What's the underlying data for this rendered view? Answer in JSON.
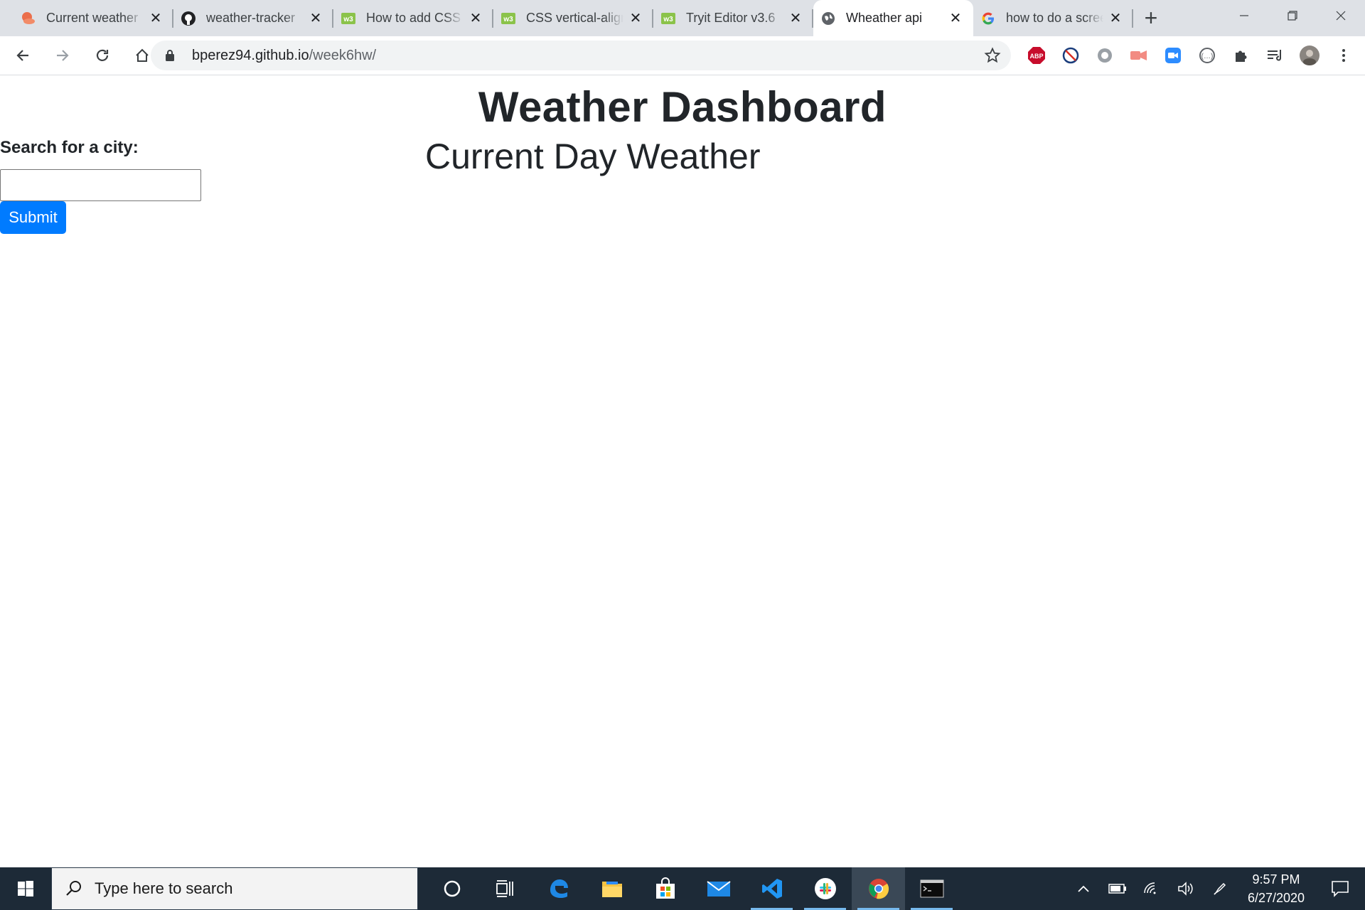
{
  "browser": {
    "tabs": [
      {
        "title": "Current weather",
        "icon": "weather-cloud-icon",
        "active": false
      },
      {
        "title": "weather-tracker",
        "icon": "github-icon",
        "active": false
      },
      {
        "title": "How to add CSS",
        "icon": "w3schools-icon",
        "active": false
      },
      {
        "title": "CSS vertical-align",
        "icon": "w3schools-icon",
        "active": false
      },
      {
        "title": "Tryit Editor v3.6",
        "icon": "w3schools-icon",
        "active": false
      },
      {
        "title": "Wheather api",
        "icon": "globe-icon",
        "active": true
      },
      {
        "title": "how to do a screenshot",
        "icon": "google-icon",
        "active": false
      }
    ],
    "url_host": "bperez94.github.io",
    "url_path": "/week6hw/"
  },
  "page": {
    "title": "Weather Dashboard",
    "search_label": "Search for a city:",
    "search_value": "",
    "submit_label": "Submit",
    "current_heading": "Current Day Weather"
  },
  "taskbar": {
    "search_placeholder": "Type here to search",
    "time": "9:57 PM",
    "date": "6/27/2020"
  },
  "colors": {
    "primary_button": "#007bff",
    "taskbar": "#1d2a37",
    "tabstrip": "#dee1e6"
  }
}
